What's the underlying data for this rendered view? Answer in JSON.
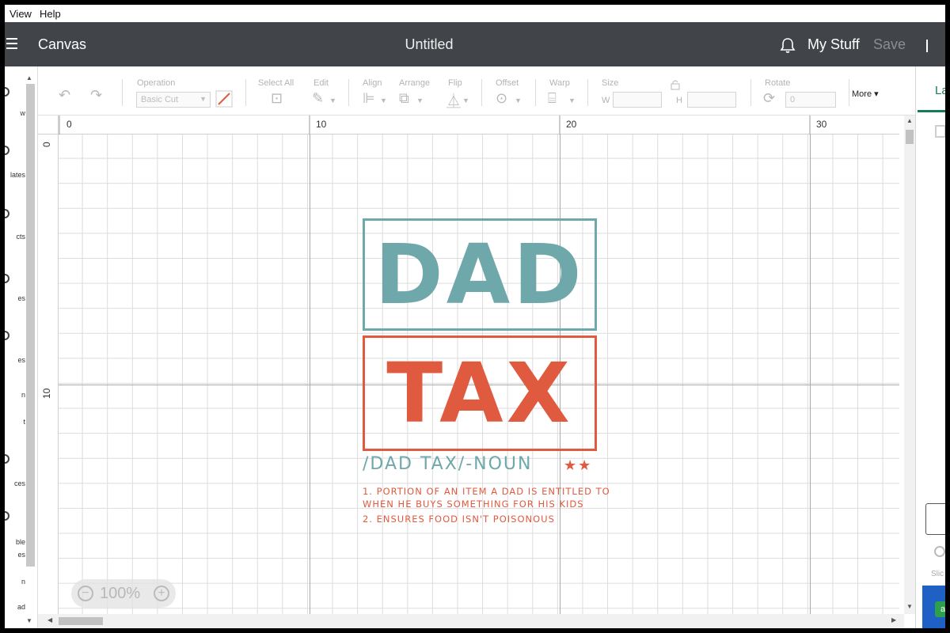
{
  "menu": {
    "view": "View",
    "help": "Help"
  },
  "header": {
    "app_name": "Canvas",
    "doc_title": "Untitled",
    "my_stuff": "My Stuff",
    "save": "Save"
  },
  "sidebar": {
    "items": [
      {
        "label": "w"
      },
      {
        "label": "lates"
      },
      {
        "label": "cts"
      },
      {
        "label": "es"
      },
      {
        "label": "es"
      },
      {
        "label": "n"
      },
      {
        "label": "t"
      },
      {
        "label": "ces"
      },
      {
        "label": "ble"
      },
      {
        "label": "es"
      },
      {
        "label": "n"
      },
      {
        "label": "ad"
      }
    ]
  },
  "toolbar": {
    "operation_label": "Operation",
    "operation_value": "Basic Cut",
    "select_all_label": "Select All",
    "edit_label": "Edit",
    "align_label": "Align",
    "arrange_label": "Arrange",
    "flip_label": "Flip",
    "offset_label": "Offset",
    "warp_label": "Warp",
    "size_label": "Size",
    "w_label": "W",
    "h_label": "H",
    "rotate_label": "Rotate",
    "rotate_value": "0",
    "more_label": "More"
  },
  "right_panel": {
    "tab_label": "La",
    "slice_label": "Slic",
    "green_btn": "a"
  },
  "ruler": {
    "h_numbers": [
      "0",
      "10",
      "20",
      "30"
    ],
    "v_numbers": [
      "0",
      "10"
    ]
  },
  "design": {
    "word1": "DAD",
    "word2": "TAX",
    "pronunciation": "/DAD TAX/-NOUN",
    "stars": "★★",
    "def1": "1. PORTION OF AN ITEM A DAD IS ENTITLED TO",
    "def2": "WHEN HE BUYS SOMETHING FOR HIS KIDS",
    "def3": "2. ENSURES FOOD ISN'T POISONOUS",
    "colors": {
      "teal": "#6fa8ab",
      "red": "#e05a3f"
    }
  },
  "zoom": {
    "value": "100%"
  }
}
